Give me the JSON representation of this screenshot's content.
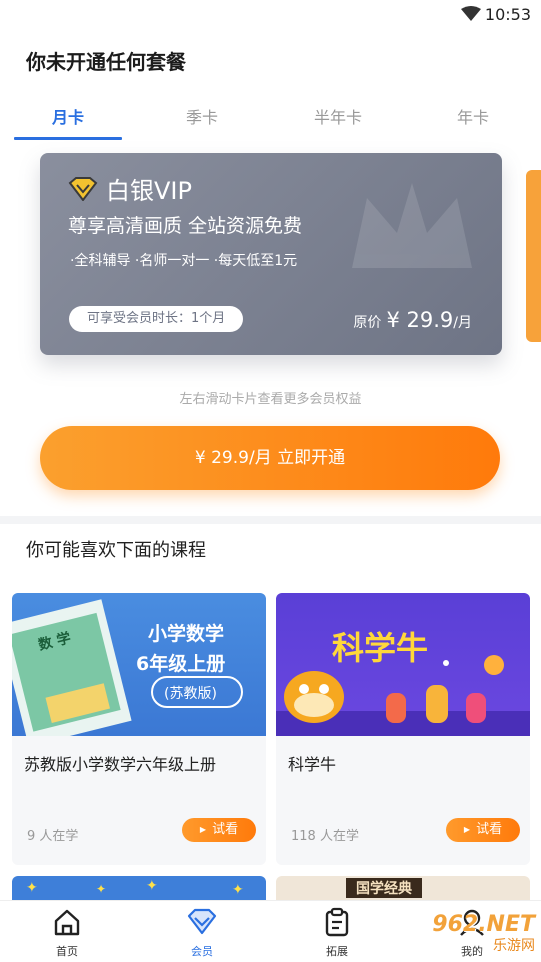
{
  "status_bar": {
    "time": "10:53"
  },
  "page_title": "你未开通任何套餐",
  "tabs": [
    {
      "label": "月卡",
      "active": true
    },
    {
      "label": "季卡",
      "active": false
    },
    {
      "label": "半年卡",
      "active": false
    },
    {
      "label": "年卡",
      "active": false
    }
  ],
  "vip_card": {
    "name": "白银VIP",
    "slogan": "尊享高清画质 全站资源免费",
    "perks": "·全科辅导 ·名师一对一 ·每天低至1元",
    "duration": "可享受会员时长：1个月",
    "original_price_label": "原价",
    "original_price": "¥ 29.9",
    "price_unit": "/月"
  },
  "swipe_hint": "左右滑动卡片查看更多会员权益",
  "buy_button": "¥ 29.9/月  立即开通",
  "section_title": "你可能喜欢下面的课程",
  "courses": [
    {
      "name": "苏教版小学数学六年级上册",
      "count": "9 人在学",
      "try_label": "试看",
      "thumb_title": "小学数学",
      "thumb_grade": "6年级上册",
      "thumb_edition": "(苏教版)",
      "book_label": "数 学"
    },
    {
      "name": "科学牛",
      "count": "118 人在学",
      "try_label": "试看",
      "thumb_title": "科学牛"
    }
  ],
  "peek_right_label": "国学经典",
  "nav": [
    {
      "label": "首页",
      "icon": "home-icon",
      "active": false
    },
    {
      "label": "会员",
      "icon": "vip-diamond-icon",
      "active": true
    },
    {
      "label": "拓展",
      "icon": "clipboard-icon",
      "active": false
    },
    {
      "label": "我的",
      "icon": "profile-icon",
      "active": false
    }
  ],
  "watermark": {
    "brand": "962.NET",
    "sub": "乐游网"
  },
  "colors": {
    "accent": "#2a6fe0",
    "orange": "#ff7a0b",
    "vip_card": "#7b8090"
  }
}
